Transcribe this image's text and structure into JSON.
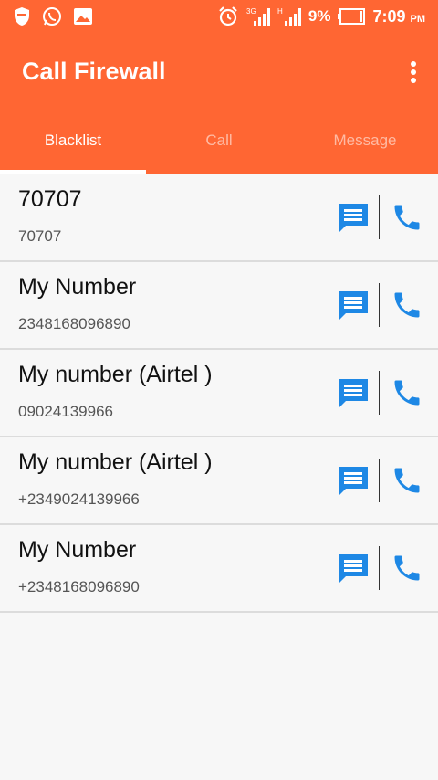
{
  "status_bar": {
    "battery_percent": "9%",
    "time": "7:09",
    "ampm": "PM",
    "network_labels": [
      "3G",
      "H"
    ]
  },
  "app_bar": {
    "title": "Call Firewall"
  },
  "tabs": [
    {
      "label": "Blacklist",
      "active": true
    },
    {
      "label": "Call",
      "active": false
    },
    {
      "label": "Message",
      "active": false
    }
  ],
  "contacts": [
    {
      "name": "70707",
      "number": "70707"
    },
    {
      "name": "My Number",
      "number": "2348168096890"
    },
    {
      "name": "My number (Airtel )",
      "number": "09024139966"
    },
    {
      "name": "My number (Airtel )",
      "number": "+2349024139966"
    },
    {
      "name": "My Number",
      "number": "+2348168096890"
    }
  ],
  "colors": {
    "accent": "#ff6633",
    "icon_blue": "#1e88e5"
  },
  "icons": {
    "row_message": "message-icon",
    "row_call": "phone-icon",
    "overflow": "more-vert-icon"
  }
}
